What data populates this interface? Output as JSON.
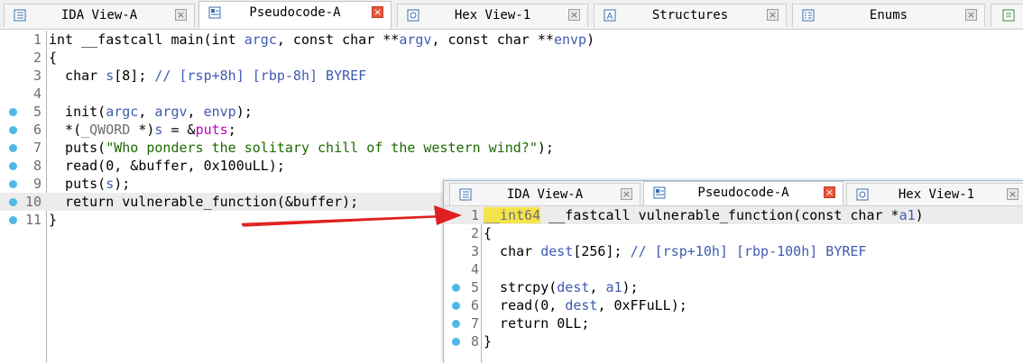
{
  "main": {
    "tabs": [
      {
        "label": "IDA View-A",
        "icon": "ida-view-icon",
        "active": false
      },
      {
        "label": "Pseudocode-A",
        "icon": "pseudocode-icon",
        "active": true
      },
      {
        "label": "Hex View-1",
        "icon": "hex-view-icon",
        "active": false
      },
      {
        "label": "Structures",
        "icon": "structures-icon",
        "active": false
      },
      {
        "label": "Enums",
        "icon": "enums-icon",
        "active": false
      }
    ],
    "lines": [
      {
        "n": "1",
        "bp": false,
        "hl": false,
        "code": "int __fastcall main(int argc, const char **argv, const char **envp)"
      },
      {
        "n": "2",
        "bp": false,
        "hl": false,
        "code": "{"
      },
      {
        "n": "3",
        "bp": false,
        "hl": false,
        "code": "  char s[8]; // [rsp+8h] [rbp-8h] BYREF"
      },
      {
        "n": "4",
        "bp": false,
        "hl": false,
        "code": ""
      },
      {
        "n": "5",
        "bp": true,
        "hl": false,
        "code": "  init(argc, argv, envp);"
      },
      {
        "n": "6",
        "bp": true,
        "hl": false,
        "code": "  *(_QWORD *)s = &puts;"
      },
      {
        "n": "7",
        "bp": true,
        "hl": false,
        "code": "  puts(\"Who ponders the solitary chill of the western wind?\");"
      },
      {
        "n": "8",
        "bp": true,
        "hl": false,
        "code": "  read(0, &buffer, 0x100uLL);"
      },
      {
        "n": "9",
        "bp": true,
        "hl": false,
        "code": "  puts(s);"
      },
      {
        "n": "10",
        "bp": true,
        "hl": true,
        "code": "  return vulnerable_function(&buffer);"
      },
      {
        "n": "11",
        "bp": true,
        "hl": false,
        "code": "}"
      }
    ]
  },
  "overlay": {
    "tabs": [
      {
        "label": "IDA View-A",
        "icon": "ida-view-icon",
        "active": false
      },
      {
        "label": "Pseudocode-A",
        "icon": "pseudocode-icon",
        "active": true
      },
      {
        "label": "Hex View-1",
        "icon": "hex-view-icon",
        "active": false
      }
    ],
    "lines": [
      {
        "n": "1",
        "bp": false,
        "hl": true,
        "code": "__int64 __fastcall vulnerable_function(const char *a1)"
      },
      {
        "n": "2",
        "bp": false,
        "hl": false,
        "code": "{"
      },
      {
        "n": "3",
        "bp": false,
        "hl": false,
        "code": "  char dest[256]; // [rsp+10h] [rbp-100h] BYREF"
      },
      {
        "n": "4",
        "bp": false,
        "hl": false,
        "code": ""
      },
      {
        "n": "5",
        "bp": true,
        "hl": false,
        "code": "  strcpy(dest, a1);"
      },
      {
        "n": "6",
        "bp": true,
        "hl": false,
        "code": "  read(0, dest, 0xFFuLL);"
      },
      {
        "n": "7",
        "bp": true,
        "hl": false,
        "code": "  return 0LL;"
      },
      {
        "n": "8",
        "bp": true,
        "hl": false,
        "code": "}"
      }
    ]
  },
  "colors": {
    "breakpoint": "#4fb8e8",
    "arrow": "#e02020",
    "highlight_line": "#ececec",
    "keyword_highlight": "#f4e44c"
  }
}
